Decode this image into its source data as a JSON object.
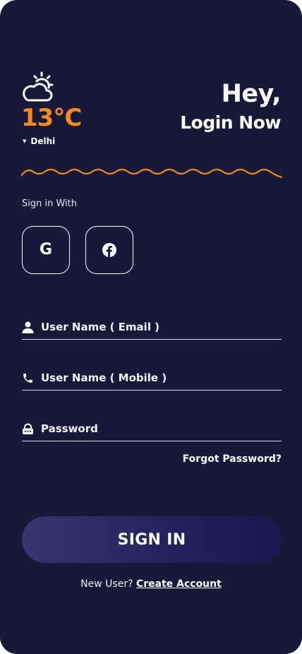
{
  "weather": {
    "icon": "partly-cloudy-icon",
    "temperature": "13°C",
    "city": "Delhi",
    "accent_color": "#f68a1e"
  },
  "greeting": {
    "line1": "Hey,",
    "line2": "Login Now"
  },
  "social": {
    "heading": "Sign in With",
    "google_icon": "google-icon",
    "facebook_icon": "facebook-icon"
  },
  "form": {
    "email_label": "User Name ( Email )",
    "mobile_label": "User Name ( Mobile )",
    "password_label": "Password",
    "forgot_label": "Forgot Password?"
  },
  "actions": {
    "signin_label": "SIGN IN",
    "new_user_text": "New User?",
    "create_account_label": "Create Account"
  },
  "colors": {
    "background": "#181838",
    "accent": "#f68a1e",
    "button": "#2c2766"
  }
}
